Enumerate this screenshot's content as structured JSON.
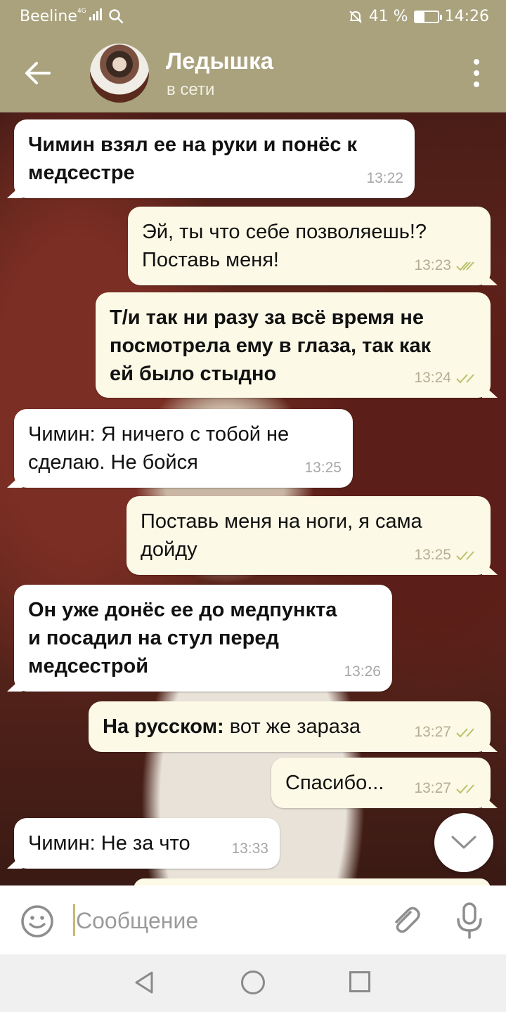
{
  "status_bar": {
    "carrier": "Beeline",
    "network": "4G",
    "battery": "41 %",
    "battery_level": 0.41,
    "time": "14:26"
  },
  "header": {
    "contact_name": "Ледышка",
    "contact_status": "в сети"
  },
  "messages": [
    {
      "lines": [
        "Чимин взял ее на руки и понёс к",
        "медсестре"
      ],
      "time": "13:22"
    },
    {
      "lines": [
        "Эй, ты что себе позволяешь!?",
        "Поставь меня!"
      ],
      "time": "13:23"
    },
    {
      "lines": [
        "Т/и так ни разу за всё время не",
        "посмотрела ему в глаза, так как",
        "ей было стыдно"
      ],
      "time": "13:24"
    },
    {
      "lines": [
        "Чимин: Я ничего с тобой не",
        "сделаю. Не бойся"
      ],
      "time": "13:25"
    },
    {
      "lines": [
        "Поставь меня на ноги, я сама",
        "дойду"
      ],
      "time": "13:25"
    },
    {
      "lines": [
        "Он уже донёс ее до медпункта",
        "и посадил на стул перед",
        "медсестрой"
      ],
      "time": "13:26"
    },
    {
      "bold_prefix": "На русском:",
      "rest": " вот же зараза",
      "time": "13:27"
    },
    {
      "lines": [
        "Спасибо..."
      ],
      "time": "13:27"
    },
    {
      "lines": [
        "Чимин: Не за что"
      ],
      "time": "13:33"
    }
  ],
  "composer": {
    "placeholder": "Сообщение"
  },
  "colors": {
    "header": "#a9a27d",
    "incoming_bubble": "#ffffff",
    "outgoing_bubble": "#fcf9e6",
    "read_ticks": "#b9c26a"
  },
  "icons": {
    "back": "arrow-left-icon",
    "menu": "more-vertical-icon",
    "read": "double-check-icon",
    "scroll": "chevron-down-icon",
    "emoji": "smiley-icon",
    "attach": "paperclip-icon",
    "mic": "microphone-icon"
  }
}
